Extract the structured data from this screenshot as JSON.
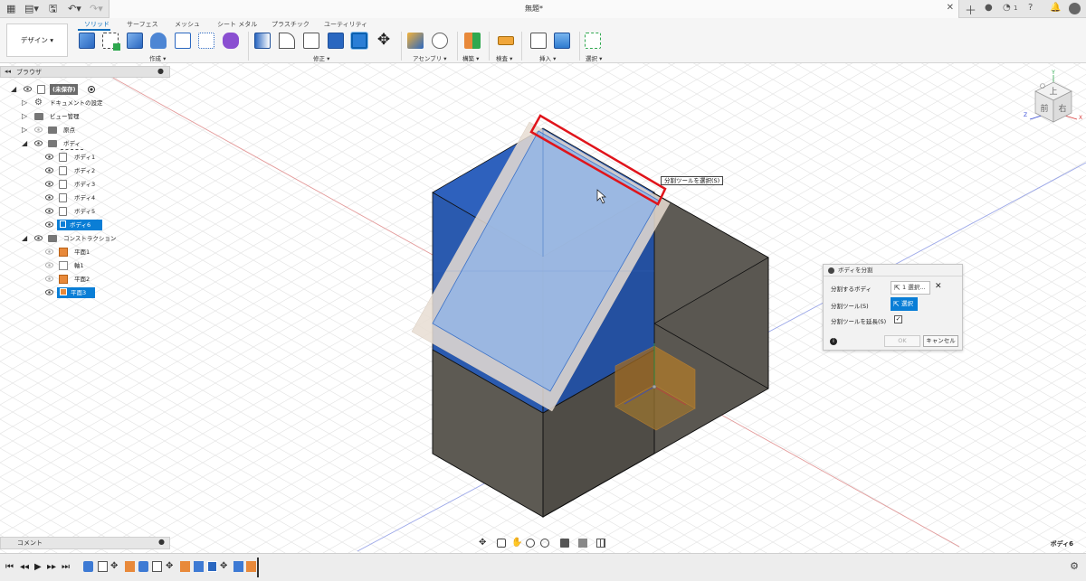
{
  "window": {
    "title": "無題*",
    "notif_count": "1"
  },
  "toolbar": {
    "design_label": "デザイン ▾",
    "tabs": [
      "ソリッド",
      "サーフェス",
      "メッシュ",
      "シート メタル",
      "プラスチック",
      "ユーティリティ"
    ],
    "groups": [
      "作成 ▾",
      "修正 ▾",
      "アセンブリ ▾",
      "構築 ▾",
      "検査 ▾",
      "挿入 ▾",
      "選択 ▾"
    ]
  },
  "browser": {
    "header": "ブラウザ",
    "root": "(未保存)",
    "items": {
      "doc_settings": "ドキュメントの設定",
      "view_mgmt": "ビュー管理",
      "origin": "原点",
      "bodies": "ボディ",
      "body1": "ボディ1",
      "body2": "ボディ2",
      "body3": "ボディ3",
      "body4": "ボディ4",
      "body5": "ボディ5",
      "body6": "ボディ6",
      "construction": "コンストラクション",
      "plane1": "平面1",
      "axis1": "軸1",
      "plane2": "平面2",
      "plane3": "平面3"
    }
  },
  "dialog": {
    "title": "ボディを分割",
    "body_to_split_label": "分割するボディ",
    "body_selected": "1 選択...",
    "tool_label": "分割ツール(S)",
    "tool_btn": "選択",
    "extend_label": "分割ツールを延長(S)",
    "extend_checked": "✓",
    "ok": "OK",
    "cancel": "キャンセル"
  },
  "tooltip": "分割ツールを選択(S)",
  "viewcube": {
    "top": "上",
    "front": "前",
    "right": "右",
    "axis_x": "X",
    "axis_y": "Y",
    "axis_z": "Z"
  },
  "comments": {
    "label": "コメント"
  },
  "status": {
    "selection": "ボディ6"
  },
  "colors": {
    "accent": "#0a7ed6",
    "body_blue": "#2b5cb5",
    "body_dark": "#5d5a55",
    "highlight_red": "#e0141b"
  }
}
